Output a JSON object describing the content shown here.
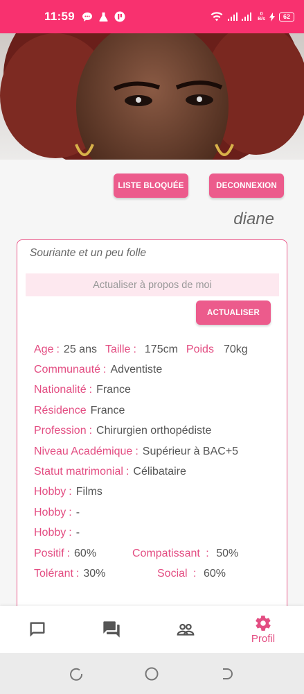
{
  "status_bar": {
    "time": "11:59",
    "speed_top": "0",
    "speed_bottom": "B/s",
    "battery": "62",
    "icons": [
      "message-bubble-icon",
      "flask-icon",
      "app-badge-icon",
      "wifi-icon",
      "signal-icon",
      "charging-icon"
    ]
  },
  "profile": {
    "blocked_list_label": "LISTE BLOQUÉE",
    "logout_label": "DECONNEXION",
    "username": "diane",
    "about": "Souriante et un peu folle",
    "about_placeholder": "Actualiser à propos de moi",
    "update_label": "ACTUALISER"
  },
  "info": {
    "age_label": "Age",
    "age": "25 ans",
    "height_label": "Taille",
    "height": "175cm",
    "weight_label": "Poids",
    "weight": "70kg",
    "community_label": "Communauté",
    "community": "Adventiste",
    "nationality_label": "Nationalité",
    "nationality": "France",
    "residence_label": "Résidence",
    "residence": "France",
    "profession_label": "Profession",
    "profession": "Chirurgien orthopédiste",
    "education_label": "Niveau Académique",
    "education": "Supérieur à BAC+5",
    "marital_label": "Statut matrimonial",
    "marital": "Célibataire",
    "hobby_label": "Hobby",
    "hobby1": "Films",
    "hobby2": "-",
    "hobby3": "-",
    "positive_label": "Positif",
    "positive": "60%",
    "compassionate_label": "Compatissant",
    "compassionate": "50%",
    "tolerant_label": "Tolérant",
    "tolerant": "30%",
    "social_label": "Social",
    "social": "60%",
    "separator": ":"
  },
  "bottom_nav": {
    "items": [
      "chat-icon",
      "forum-icon",
      "people-icon",
      "settings-icon"
    ],
    "active_label": "Profil"
  },
  "colors": {
    "accent": "#f8316f",
    "button": "#ec5b8c",
    "label": "#e34d82"
  }
}
